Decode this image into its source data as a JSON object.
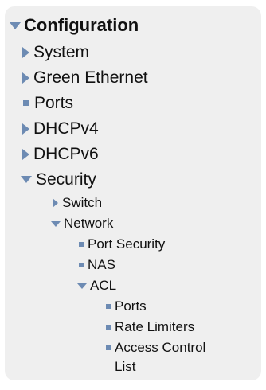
{
  "menu": {
    "configuration": "Configuration",
    "system": "System",
    "green_ethernet": "Green Ethernet",
    "ports": "Ports",
    "dhcpv4": "DHCPv4",
    "dhcpv6": "DHCPv6",
    "security": "Security",
    "switch": "Switch",
    "network": "Network",
    "port_security": "Port Security",
    "nas": "NAS",
    "acl": "ACL",
    "acl_ports": "Ports",
    "rate_limiters": "Rate Limiters",
    "access_control_list_line1": "Access Control",
    "access_control_list_line2": "List"
  },
  "icons": {
    "expanded": "triangle-down-icon",
    "collapsed": "triangle-right-icon",
    "leaf": "square-bullet-icon"
  },
  "colors": {
    "panel_background": "#efefef",
    "icon": "#6d8bb3",
    "text": "#111111"
  }
}
